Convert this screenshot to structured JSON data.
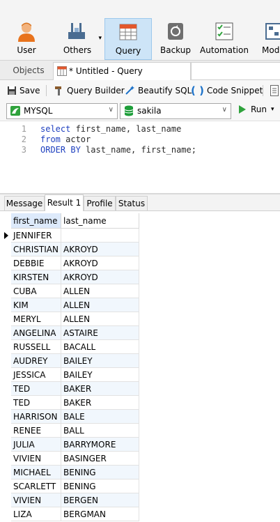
{
  "ribbon": {
    "items": [
      {
        "label": "User",
        "icon": "user-icon"
      },
      {
        "label": "Others",
        "icon": "tools-icon"
      },
      {
        "label": "Query",
        "icon": "query-table-icon",
        "active": true
      },
      {
        "label": "Backup",
        "icon": "backup-icon"
      },
      {
        "label": "Automation",
        "icon": "automation-checklist-icon"
      },
      {
        "label": "Mod",
        "icon": "model-icon"
      }
    ]
  },
  "tabs": {
    "objects": "Objects",
    "query": "* Untitled - Query"
  },
  "toolbar": {
    "save": "Save",
    "query_builder": "Query Builder",
    "beautify": "Beautify SQL",
    "snippet": "Code Snippet"
  },
  "connection": {
    "connection_value": "MYSQL",
    "database_value": "sakila",
    "run": "Run"
  },
  "editor": {
    "lines": [
      {
        "num": "1",
        "kw1": "select",
        "rest1": " first_name, last_name",
        "kw2": "",
        "rest2": ""
      },
      {
        "num": "2",
        "kw1": "from",
        "rest1": " actor",
        "kw2": "",
        "rest2": ""
      },
      {
        "num": "3",
        "kw1": "ORDER BY",
        "rest1": " last_name, first_name;",
        "kw2": "",
        "rest2": ""
      }
    ]
  },
  "result_tabs": [
    "Message",
    "Result 1",
    "Profile",
    "Status"
  ],
  "grid": {
    "columns": [
      "first_name",
      "last_name"
    ],
    "rows": [
      [
        "JENNIFER",
        ""
      ],
      [
        "CHRISTIAN",
        "AKROYD"
      ],
      [
        "DEBBIE",
        "AKROYD"
      ],
      [
        "KIRSTEN",
        "AKROYD"
      ],
      [
        "CUBA",
        "ALLEN"
      ],
      [
        "KIM",
        "ALLEN"
      ],
      [
        "MERYL",
        "ALLEN"
      ],
      [
        "ANGELINA",
        "ASTAIRE"
      ],
      [
        "RUSSELL",
        "BACALL"
      ],
      [
        "AUDREY",
        "BAILEY"
      ],
      [
        "JESSICA",
        "BAILEY"
      ],
      [
        "TED",
        "BAKER"
      ],
      [
        "TED",
        "BAKER"
      ],
      [
        "HARRISON",
        "BALE"
      ],
      [
        "RENEE",
        "BALL"
      ],
      [
        "JULIA",
        "BARRYMORE"
      ],
      [
        "VIVIEN",
        "BASINGER"
      ],
      [
        "MICHAEL",
        "BENING"
      ],
      [
        "SCARLETT",
        "BENING"
      ],
      [
        "VIVIEN",
        "BERGEN"
      ],
      [
        "LIZA",
        "BERGMAN"
      ]
    ]
  },
  "colors": {
    "accent": "#cde4f7",
    "keyword": "#1d3fbf",
    "run_green": "#2fa23c",
    "db_green": "#1e9e3a"
  }
}
